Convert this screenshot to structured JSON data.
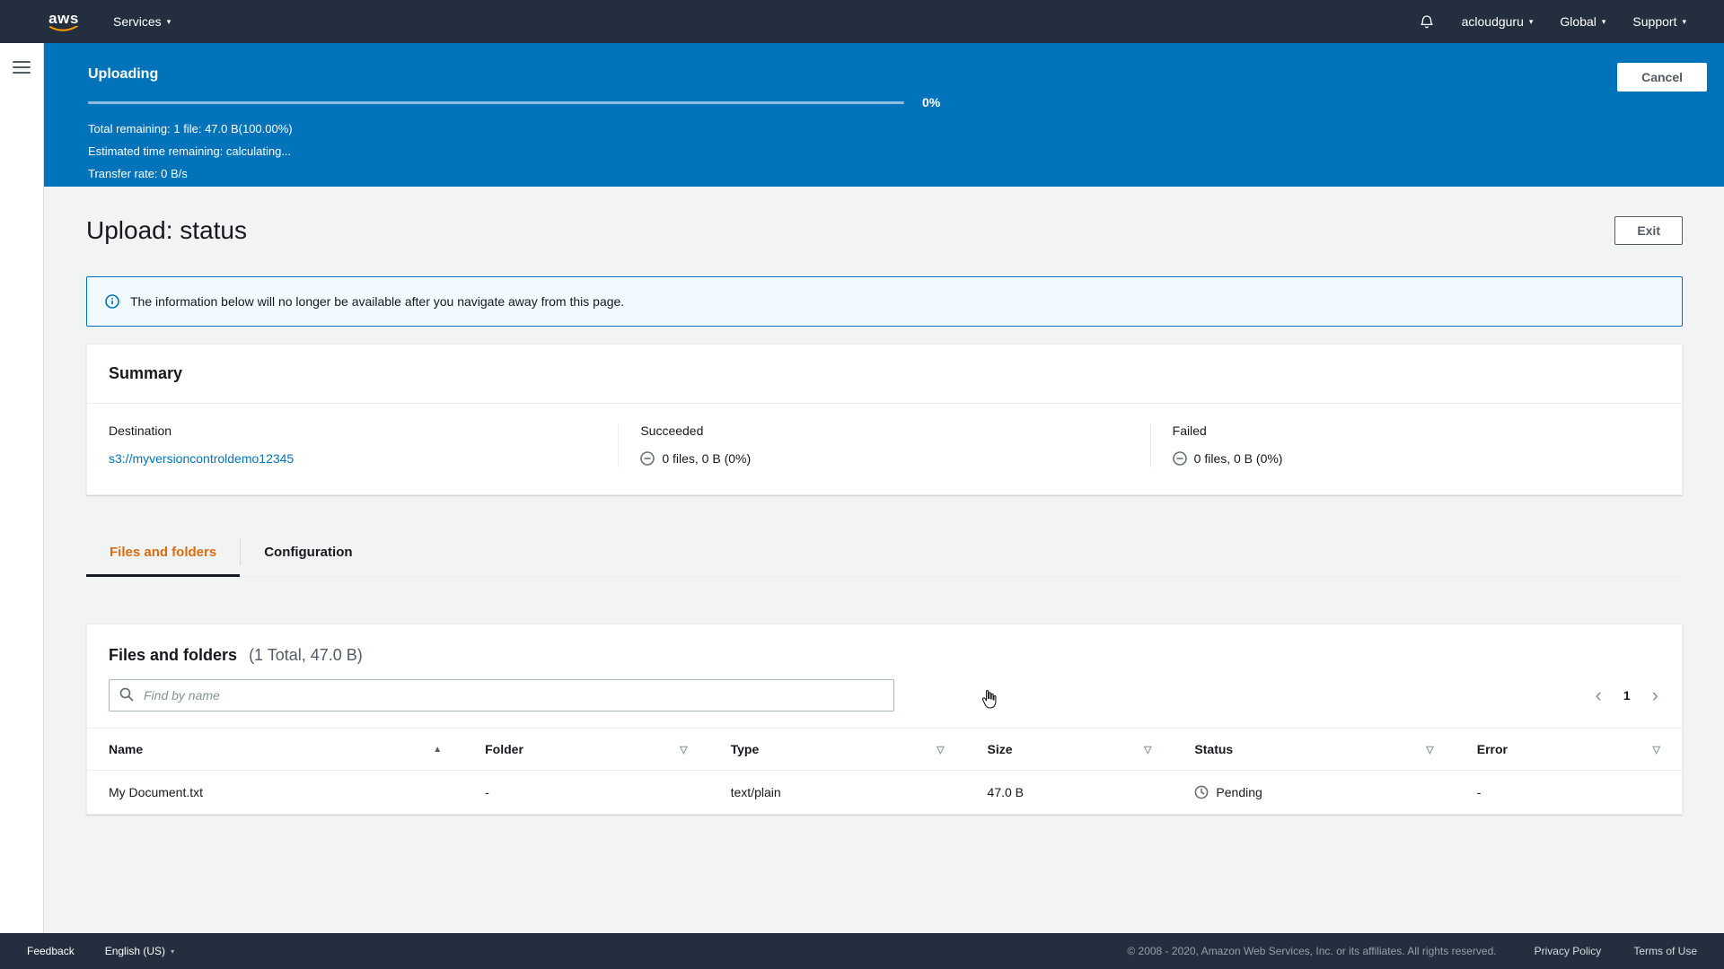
{
  "colors": {
    "nav_bg": "#232f3e",
    "banner_bg": "#0073bb",
    "link": "#0073bb",
    "active_tab": "#dd6b10",
    "page_bg": "#f2f3f3",
    "aws_orange": "#ff9900"
  },
  "header": {
    "logo": "aws",
    "services_label": "Services",
    "account_label": "acloudguru",
    "region_label": "Global",
    "support_label": "Support"
  },
  "upload_banner": {
    "title": "Uploading",
    "percent_label": "0%",
    "total_remaining": "Total remaining: 1 file: 47.0 B(100.00%)",
    "estimated_time": "Estimated time remaining: calculating...",
    "transfer_rate": "Transfer rate: 0 B/s",
    "cancel_label": "Cancel"
  },
  "page": {
    "title": "Upload: status",
    "exit_label": "Exit",
    "info_message": "The information below will no longer be available after you navigate away from this page."
  },
  "summary": {
    "title": "Summary",
    "destination": {
      "label": "Destination",
      "value": "s3://myversioncontroldemo12345"
    },
    "succeeded": {
      "label": "Succeeded",
      "value": "0 files, 0 B (0%)"
    },
    "failed": {
      "label": "Failed",
      "value": "0 files, 0 B (0%)"
    }
  },
  "tabs": [
    {
      "label": "Files and folders"
    },
    {
      "label": "Configuration"
    }
  ],
  "files_panel": {
    "title": "Files and folders",
    "subtitle": "(1 Total, 47.0 B)",
    "search_placeholder": "Find by name",
    "page_number": "1",
    "columns": {
      "name": "Name",
      "folder": "Folder",
      "type": "Type",
      "size": "Size",
      "status": "Status",
      "error": "Error"
    },
    "rows": [
      {
        "name": "My Document.txt",
        "folder": "-",
        "type": "text/plain",
        "size": "47.0 B",
        "status": "Pending",
        "error": "-"
      }
    ]
  },
  "footer": {
    "feedback_label": "Feedback",
    "language_label": "English (US)",
    "copyright": "© 2008 - 2020, Amazon Web Services, Inc. or its affiliates. All rights reserved.",
    "privacy_label": "Privacy Policy",
    "terms_label": "Terms of Use"
  }
}
